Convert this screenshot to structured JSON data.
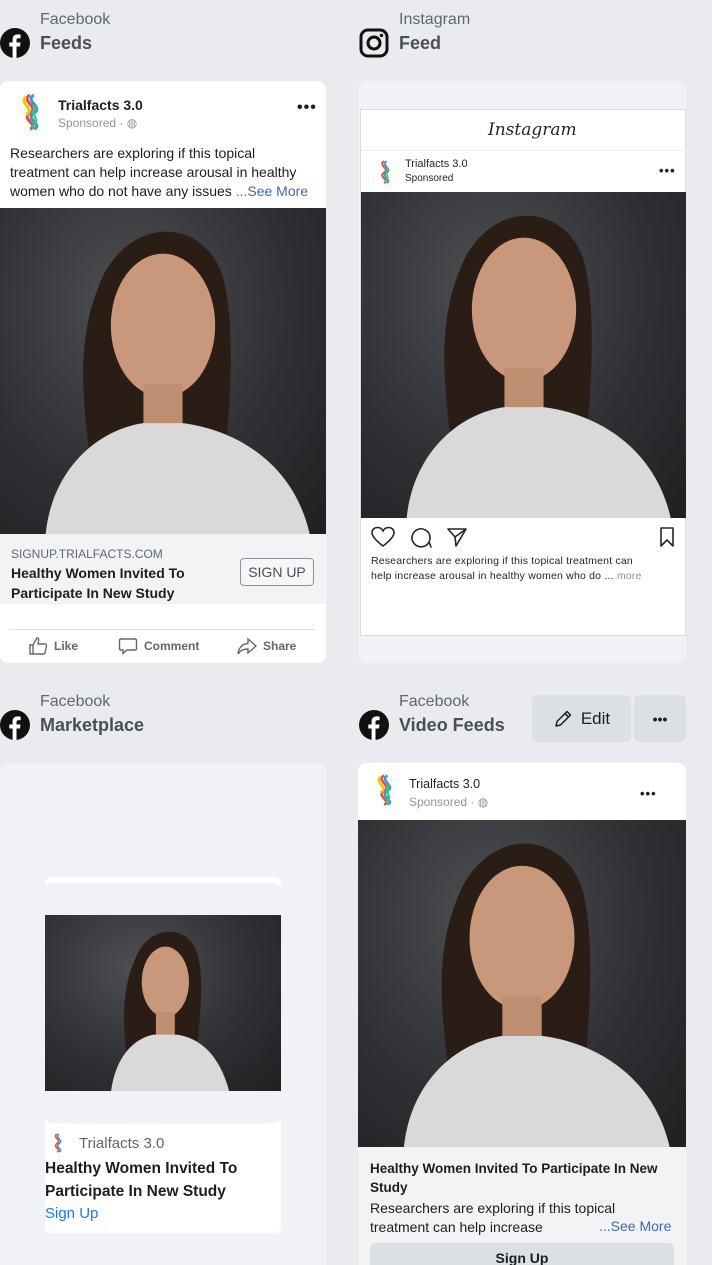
{
  "sections": {
    "fb_feeds": {
      "platform": "Facebook",
      "placement": "Feeds"
    },
    "ig_feed": {
      "platform": "Instagram",
      "placement": "Feed"
    },
    "fb_marketplace": {
      "platform": "Facebook",
      "placement": "Marketplace"
    },
    "fb_video": {
      "platform": "Facebook",
      "placement": "Video Feeds"
    }
  },
  "ad": {
    "brand": "Trialfacts 3.0",
    "sponsored": "Sponsored · ",
    "sponsored_ig": "Sponsored",
    "primary_text_1": "Researchers are exploring if this topical",
    "primary_text_2": "treatment can help increase arousal in healthy",
    "primary_text_3": "women who do not have any issues",
    "see_more": "...See More",
    "domain": "SIGNUP.TRIALFACTS.COM",
    "headline_1": "Healthy Women Invited To",
    "headline_2": "Participate In New Study",
    "cta": "SIGN UP"
  },
  "fb_actions": {
    "like": "Like",
    "comment": "Comment",
    "share": "Share"
  },
  "instagram": {
    "logo_text": "Instagram",
    "caption_1": "Researchers are exploring if this topical treatment can",
    "caption_2": "help increase arousal in healthy women who do ...",
    "more": "more"
  },
  "marketplace": {
    "brand": "Trialfacts 3.0",
    "headline_1": "Healthy Women Invited To",
    "headline_2": "Participate In New Study",
    "cta": "Sign Up"
  },
  "video": {
    "headline_1": "Healthy Women Invited To Participate In New",
    "headline_2": "Study",
    "text_1": "Researchers are exploring if this topical",
    "text_2": "treatment can help increase",
    "see_more": "...See More",
    "cta": "Sign Up"
  },
  "toolbar": {
    "edit": "Edit",
    "more": "•••"
  },
  "colors": {
    "facebook_blue": "#4267b2",
    "bg": "#e9ebee"
  }
}
